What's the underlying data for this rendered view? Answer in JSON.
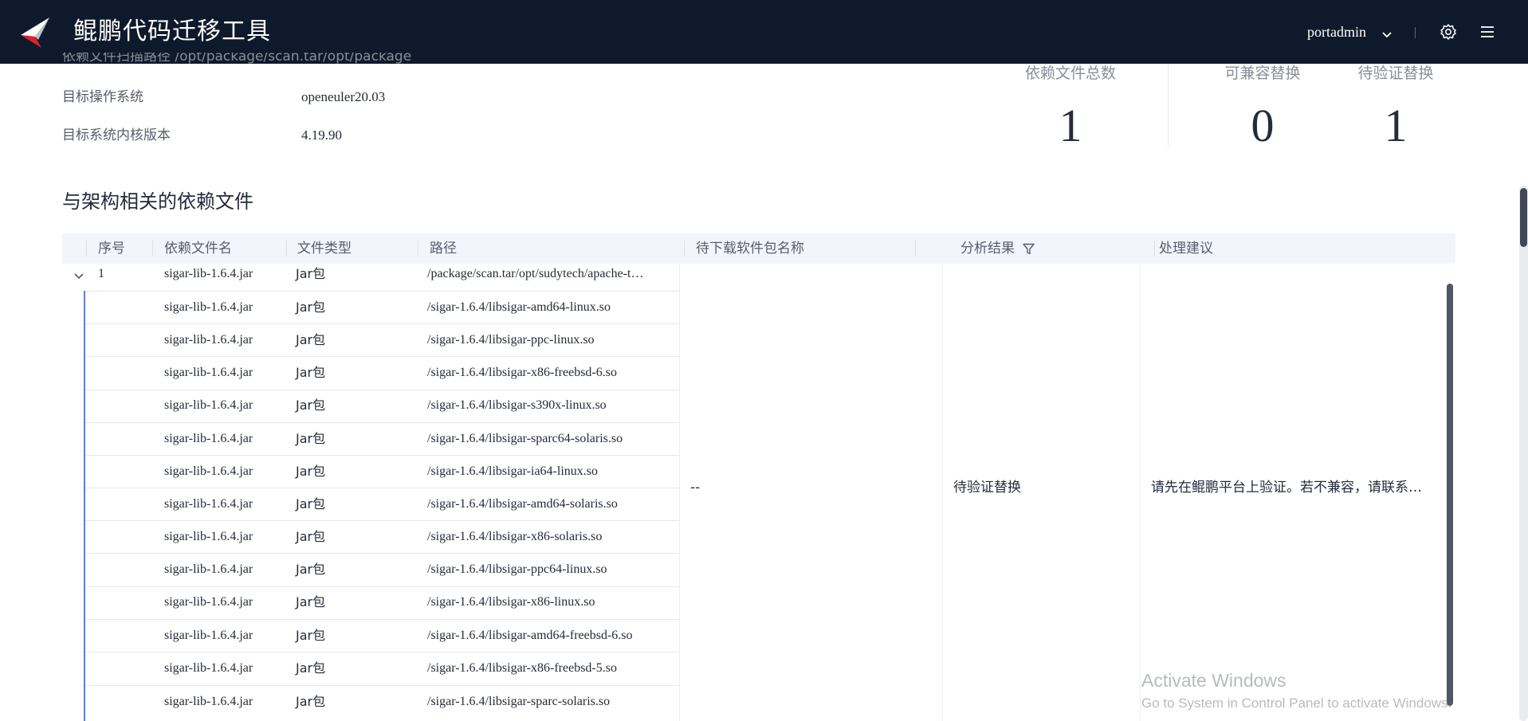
{
  "header": {
    "app_title": "鲲鹏代码迁移工具",
    "user_name": "portadmin",
    "icons": [
      "kunpeng-logo-icon",
      "chevron-down-icon",
      "gear-icon",
      "menu-icon"
    ]
  },
  "info": {
    "clipped_row_text": "依赖文件扫描路径 /opt/package/scan.tar/opt/package",
    "rows": [
      {
        "label": "目标操作系统",
        "value": "openeuler20.03"
      },
      {
        "label": "目标系统内核版本",
        "value": "4.19.90"
      }
    ]
  },
  "stats": [
    {
      "label": "依赖文件总数",
      "value": "1"
    },
    {
      "label": "可兼容替换",
      "value": "0"
    },
    {
      "label": "待验证替换",
      "value": "1"
    }
  ],
  "section_title": "与架构相关的依赖文件",
  "table": {
    "headers": {
      "index": "序号",
      "file_name": "依赖文件名",
      "file_type": "文件类型",
      "path": "路径",
      "package_name": "待下载软件包名称",
      "result": "分析结果",
      "suggestion": "处理建议"
    },
    "parent_row": {
      "index": "1",
      "file_name": "sigar-lib-1.6.4.jar",
      "file_type": "Jar包",
      "path": "/package/scan.tar/opt/sudytech/apache-t…"
    },
    "children": [
      {
        "file_name": "sigar-lib-1.6.4.jar",
        "file_type": "Jar包",
        "path": "/sigar-1.6.4/libsigar-amd64-linux.so"
      },
      {
        "file_name": "sigar-lib-1.6.4.jar",
        "file_type": "Jar包",
        "path": "/sigar-1.6.4/libsigar-ppc-linux.so"
      },
      {
        "file_name": "sigar-lib-1.6.4.jar",
        "file_type": "Jar包",
        "path": "/sigar-1.6.4/libsigar-x86-freebsd-6.so"
      },
      {
        "file_name": "sigar-lib-1.6.4.jar",
        "file_type": "Jar包",
        "path": "/sigar-1.6.4/libsigar-s390x-linux.so"
      },
      {
        "file_name": "sigar-lib-1.6.4.jar",
        "file_type": "Jar包",
        "path": "/sigar-1.6.4/libsigar-sparc64-solaris.so"
      },
      {
        "file_name": "sigar-lib-1.6.4.jar",
        "file_type": "Jar包",
        "path": "/sigar-1.6.4/libsigar-ia64-linux.so"
      },
      {
        "file_name": "sigar-lib-1.6.4.jar",
        "file_type": "Jar包",
        "path": "/sigar-1.6.4/libsigar-amd64-solaris.so"
      },
      {
        "file_name": "sigar-lib-1.6.4.jar",
        "file_type": "Jar包",
        "path": "/sigar-1.6.4/libsigar-x86-solaris.so"
      },
      {
        "file_name": "sigar-lib-1.6.4.jar",
        "file_type": "Jar包",
        "path": "/sigar-1.6.4/libsigar-ppc64-linux.so"
      },
      {
        "file_name": "sigar-lib-1.6.4.jar",
        "file_type": "Jar包",
        "path": "/sigar-1.6.4/libsigar-x86-linux.so"
      },
      {
        "file_name": "sigar-lib-1.6.4.jar",
        "file_type": "Jar包",
        "path": "/sigar-1.6.4/libsigar-amd64-freebsd-6.so"
      },
      {
        "file_name": "sigar-lib-1.6.4.jar",
        "file_type": "Jar包",
        "path": "/sigar-1.6.4/libsigar-x86-freebsd-5.so"
      },
      {
        "file_name": "sigar-lib-1.6.4.jar",
        "file_type": "Jar包",
        "path": "/sigar-1.6.4/libsigar-sparc-solaris.so"
      }
    ],
    "merged": {
      "package_name": "--",
      "result": "待验证替换",
      "suggestion": "请先在鲲鹏平台上验证。若不兼容，请联系…"
    }
  },
  "watermark": {
    "line1": "Activate Windows",
    "line2": "Go to System in Control Panel to activate Windows."
  },
  "colors": {
    "header_bg": "#0e1a2b",
    "table_header_bg": "#f2f5fc",
    "tree_line": "#5e7ce0",
    "logo_red": "#e0202a"
  }
}
